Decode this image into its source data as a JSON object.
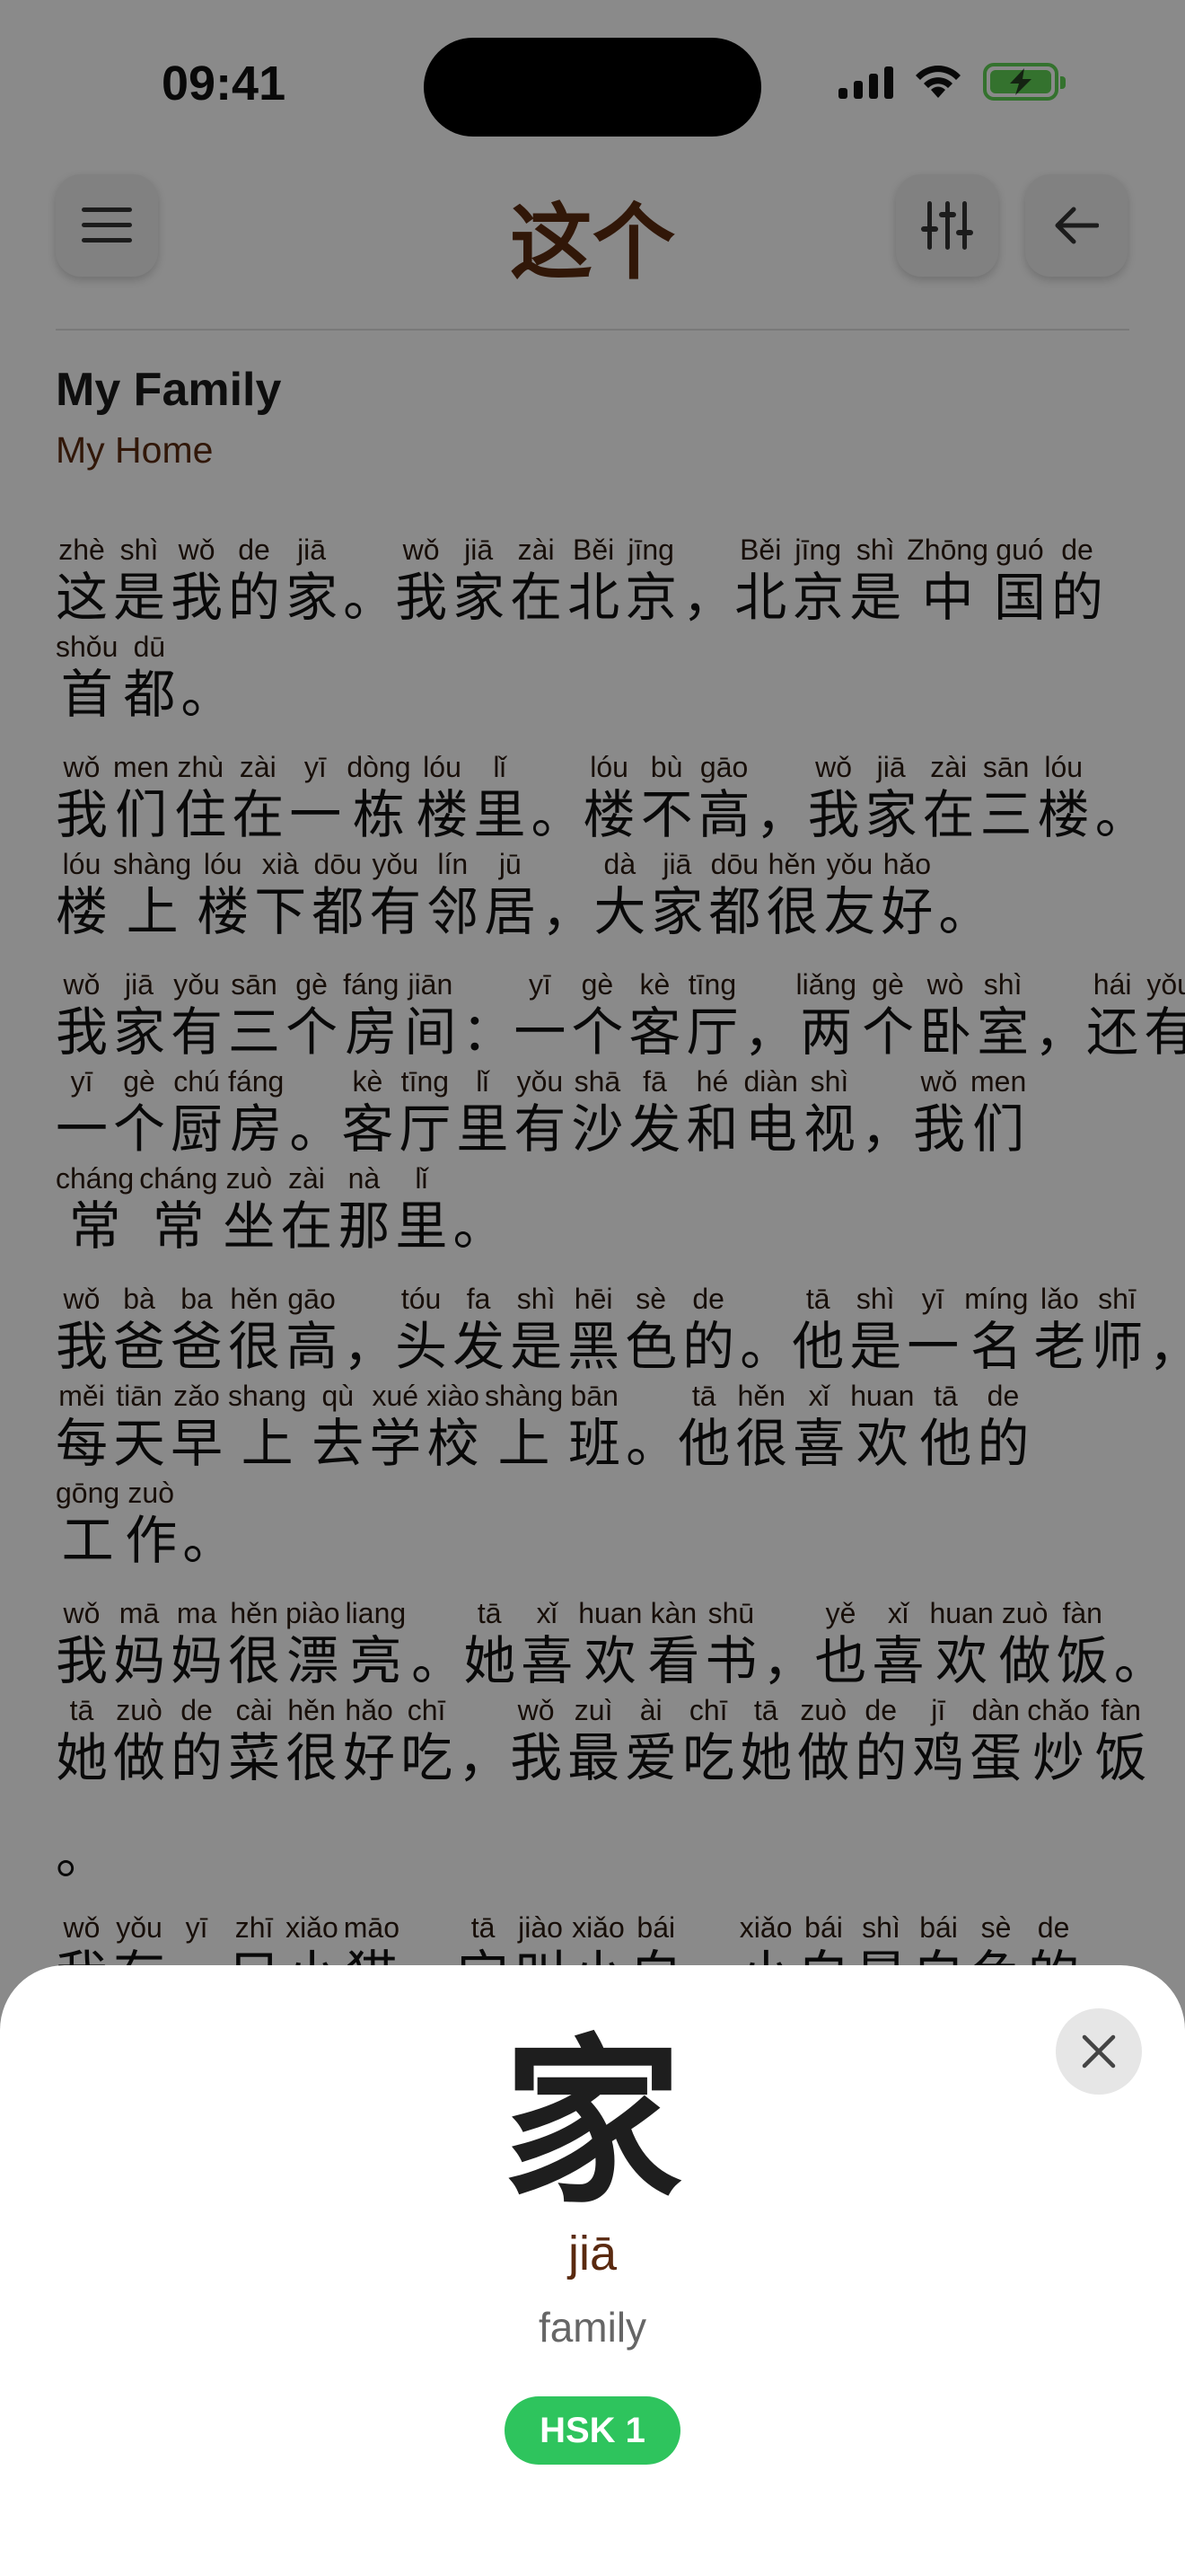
{
  "status": {
    "time": "09:41"
  },
  "nav": {
    "title": "这个"
  },
  "story": {
    "title": "My Family",
    "subtitle": "My Home"
  },
  "paragraphs": [
    [
      [
        [
          "zhè",
          "这"
        ],
        [
          "shì",
          "是"
        ],
        [
          "wǒ",
          "我"
        ],
        [
          "de",
          "的"
        ],
        [
          "jiā",
          "家"
        ],
        [
          "",
          "。"
        ],
        [
          "wǒ",
          "我"
        ],
        [
          "jiā",
          "家"
        ],
        [
          "zài",
          "在"
        ],
        [
          "Běi",
          "北"
        ],
        [
          "jīng",
          "京"
        ],
        [
          "",
          "，"
        ],
        [
          "Běi",
          "北"
        ],
        [
          "jīng",
          "京"
        ],
        [
          "shì",
          "是"
        ],
        [
          "Zhōng",
          "中"
        ],
        [
          "guó",
          "国"
        ],
        [
          "de",
          "的"
        ]
      ],
      [
        [
          "shǒu",
          "首"
        ],
        [
          "dū",
          "都"
        ],
        [
          "",
          "。"
        ]
      ]
    ],
    [
      [
        [
          "wǒ",
          "我"
        ],
        [
          "men",
          "们"
        ],
        [
          "zhù",
          "住"
        ],
        [
          "zài",
          "在"
        ],
        [
          "yī",
          "一"
        ],
        [
          "dòng",
          "栋"
        ],
        [
          "lóu",
          "楼"
        ],
        [
          "lǐ",
          "里"
        ],
        [
          "",
          "。"
        ],
        [
          "lóu",
          "楼"
        ],
        [
          "bù",
          "不"
        ],
        [
          "gāo",
          "高"
        ],
        [
          "",
          "，"
        ],
        [
          "wǒ",
          "我"
        ],
        [
          "jiā",
          "家"
        ],
        [
          "zài",
          "在"
        ],
        [
          "sān",
          "三"
        ],
        [
          "lóu",
          "楼"
        ],
        [
          "",
          "。"
        ]
      ],
      [
        [
          "lóu",
          "楼"
        ],
        [
          "shàng",
          "上"
        ],
        [
          "lóu",
          "楼"
        ],
        [
          "xià",
          "下"
        ],
        [
          "dōu",
          "都"
        ],
        [
          "yǒu",
          "有"
        ],
        [
          "lín",
          "邻"
        ],
        [
          "jū",
          "居"
        ],
        [
          "",
          "，"
        ],
        [
          "dà",
          "大"
        ],
        [
          "jiā",
          "家"
        ],
        [
          "dōu",
          "都"
        ],
        [
          "hěn",
          "很"
        ],
        [
          "yǒu",
          "友"
        ],
        [
          "hǎo",
          "好"
        ],
        [
          "",
          "。"
        ]
      ]
    ],
    [
      [
        [
          "wǒ",
          "我"
        ],
        [
          "jiā",
          "家"
        ],
        [
          "yǒu",
          "有"
        ],
        [
          "sān",
          "三"
        ],
        [
          "gè",
          "个"
        ],
        [
          "fáng",
          "房"
        ],
        [
          "jiān",
          "间"
        ],
        [
          "",
          "："
        ],
        [
          "yī",
          "一"
        ],
        [
          "gè",
          "个"
        ],
        [
          "kè",
          "客"
        ],
        [
          "tīng",
          "厅"
        ],
        [
          "",
          "，"
        ],
        [
          "liǎng",
          "两"
        ],
        [
          "gè",
          "个"
        ],
        [
          "wò",
          "卧"
        ],
        [
          "shì",
          "室"
        ],
        [
          "",
          "，"
        ],
        [
          "hái",
          "还"
        ],
        [
          "yǒu",
          "有"
        ]
      ],
      [
        [
          "yī",
          "一"
        ],
        [
          "gè",
          "个"
        ],
        [
          "chú",
          "厨"
        ],
        [
          "fáng",
          "房"
        ],
        [
          "",
          "。"
        ],
        [
          "kè",
          "客"
        ],
        [
          "tīng",
          "厅"
        ],
        [
          "lǐ",
          "里"
        ],
        [
          "yǒu",
          "有"
        ],
        [
          "shā",
          "沙"
        ],
        [
          "fā",
          "发"
        ],
        [
          "hé",
          "和"
        ],
        [
          "diàn",
          "电"
        ],
        [
          "shì",
          "视"
        ],
        [
          "",
          "，"
        ],
        [
          "wǒ",
          "我"
        ],
        [
          "men",
          "们"
        ]
      ],
      [
        [
          "cháng",
          "常"
        ],
        [
          "cháng",
          "常"
        ],
        [
          "zuò",
          "坐"
        ],
        [
          "zài",
          "在"
        ],
        [
          "nà",
          "那"
        ],
        [
          "lǐ",
          "里"
        ],
        [
          "",
          "。"
        ]
      ]
    ],
    [
      [
        [
          "wǒ",
          "我"
        ],
        [
          "bà",
          "爸"
        ],
        [
          "ba",
          "爸"
        ],
        [
          "hěn",
          "很"
        ],
        [
          "gāo",
          "高"
        ],
        [
          "",
          "，"
        ],
        [
          "tóu",
          "头"
        ],
        [
          "fa",
          "发"
        ],
        [
          "shì",
          "是"
        ],
        [
          "hēi",
          "黑"
        ],
        [
          "sè",
          "色"
        ],
        [
          "de",
          "的"
        ],
        [
          "",
          "。"
        ],
        [
          "tā",
          "他"
        ],
        [
          "shì",
          "是"
        ],
        [
          "yī",
          "一"
        ],
        [
          "míng",
          "名"
        ],
        [
          "lǎo",
          "老"
        ],
        [
          "shī",
          "师"
        ],
        [
          "",
          "，"
        ]
      ],
      [
        [
          "měi",
          "每"
        ],
        [
          "tiān",
          "天"
        ],
        [
          "zǎo",
          "早"
        ],
        [
          "shang",
          "上"
        ],
        [
          "qù",
          "去"
        ],
        [
          "xué",
          "学"
        ],
        [
          "xiào",
          "校"
        ],
        [
          "shàng",
          "上"
        ],
        [
          "bān",
          "班"
        ],
        [
          "",
          "。"
        ],
        [
          "tā",
          "他"
        ],
        [
          "hěn",
          "很"
        ],
        [
          "xǐ",
          "喜"
        ],
        [
          "huan",
          "欢"
        ],
        [
          "tā",
          "他"
        ],
        [
          "de",
          "的"
        ]
      ],
      [
        [
          "gōng",
          "工"
        ],
        [
          "zuò",
          "作"
        ],
        [
          "",
          "。"
        ]
      ]
    ],
    [
      [
        [
          "wǒ",
          "我"
        ],
        [
          "mā",
          "妈"
        ],
        [
          "ma",
          "妈"
        ],
        [
          "hěn",
          "很"
        ],
        [
          "piào",
          "漂"
        ],
        [
          "liang",
          "亮"
        ],
        [
          "",
          "。"
        ],
        [
          "tā",
          "她"
        ],
        [
          "xǐ",
          "喜"
        ],
        [
          "huan",
          "欢"
        ],
        [
          "kàn",
          "看"
        ],
        [
          "shū",
          "书"
        ],
        [
          "",
          "，"
        ],
        [
          "yě",
          "也"
        ],
        [
          "xǐ",
          "喜"
        ],
        [
          "huan",
          "欢"
        ],
        [
          "zuò",
          "做"
        ],
        [
          "fàn",
          "饭"
        ],
        [
          "",
          "。"
        ]
      ],
      [
        [
          "tā",
          "她"
        ],
        [
          "zuò",
          "做"
        ],
        [
          "de",
          "的"
        ],
        [
          "cài",
          "菜"
        ],
        [
          "hěn",
          "很"
        ],
        [
          "hǎo",
          "好"
        ],
        [
          "chī",
          "吃"
        ],
        [
          "",
          "，"
        ],
        [
          "wǒ",
          "我"
        ],
        [
          "zuì",
          "最"
        ],
        [
          "ài",
          "爱"
        ],
        [
          "chī",
          "吃"
        ],
        [
          "tā",
          "她"
        ],
        [
          "zuò",
          "做"
        ],
        [
          "de",
          "的"
        ],
        [
          "jī",
          "鸡"
        ],
        [
          "dàn",
          "蛋"
        ],
        [
          "chǎo",
          "炒"
        ],
        [
          "fàn",
          "饭"
        ]
      ],
      [
        [
          "",
          "。"
        ]
      ]
    ],
    [
      [
        [
          "wǒ",
          "我"
        ],
        [
          "yǒu",
          "有"
        ],
        [
          "yī",
          "一"
        ],
        [
          "zhī",
          "只"
        ],
        [
          "xiǎo",
          "小"
        ],
        [
          "māo",
          "猫"
        ],
        [
          "",
          "，"
        ],
        [
          "tā",
          "它"
        ],
        [
          "jiào",
          "叫"
        ],
        [
          "xiǎo",
          "小"
        ],
        [
          "bái",
          "白"
        ],
        [
          "",
          "。"
        ],
        [
          "xiǎo",
          "小"
        ],
        [
          "bái",
          "白"
        ],
        [
          "shì",
          "是"
        ],
        [
          "bái",
          "白"
        ],
        [
          "sè",
          "色"
        ],
        [
          "de",
          "的"
        ]
      ]
    ]
  ],
  "sheet": {
    "character": "家",
    "pinyin": "jiā",
    "meaning": "family",
    "hsk": "HSK 1"
  }
}
